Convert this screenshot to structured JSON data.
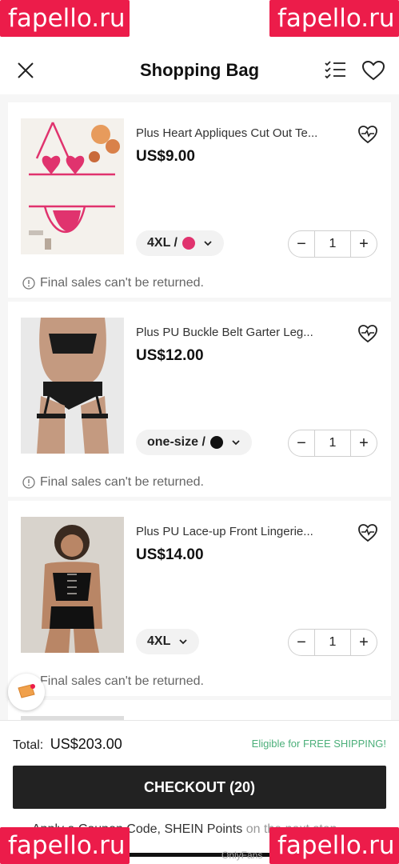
{
  "header": {
    "title": "Shopping Bag"
  },
  "watermark": {
    "text": "fapello.ru"
  },
  "items": [
    {
      "name": "Plus Heart Appliques Cut Out Te...",
      "price": "US$9.00",
      "variant_label": "4XL /",
      "quantity": "1",
      "note": "Final sales can't be returned.",
      "swatch_color": "#e0336e"
    },
    {
      "name": "Plus PU Buckle Belt Garter Leg...",
      "price": "US$12.00",
      "variant_label": "one-size /",
      "quantity": "1",
      "note": "Final sales can't be returned.",
      "swatch_color": "#111111"
    },
    {
      "name": "Plus PU Lace-up Front Lingerie...",
      "price": "US$14.00",
      "variant_label": "4XL",
      "quantity": "1",
      "note": "Final sales can't be returned."
    }
  ],
  "footer": {
    "total_label": "Total:",
    "total_value": "US$203.00",
    "shipping_text": "Eligible for FREE SHIPPING!",
    "checkout_label": "CHECKOUT (20)",
    "coupon_text": "Apply a Coupon Code, SHEIN Points",
    "coupon_suffix": " on the next step"
  },
  "bottom_label": "OnlyFans",
  "colors": {
    "accent_pink": "#ec1c4a",
    "checkout_bg": "#222222",
    "free_shipping": "#4caf7a"
  }
}
